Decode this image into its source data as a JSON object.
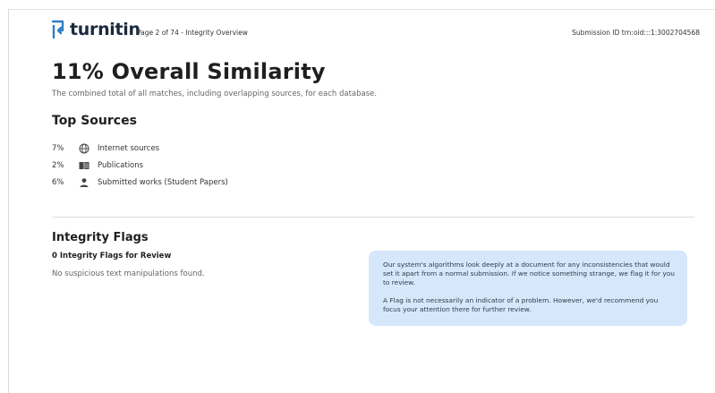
{
  "header": {
    "logo_text": "turnitin",
    "page_label": "Page 2 of 74 - Integrity Overview",
    "submission_id": "Submission ID trn:oid:::1:3002704568",
    "logo_icon": "turnitin-logo-icon",
    "brand_color": "#2f7dc6"
  },
  "overview": {
    "title": "11% Overall Similarity",
    "subtitle": "The combined total of all matches, including overlapping sources, for each database."
  },
  "top_sources": {
    "heading": "Top Sources",
    "items": [
      {
        "percent": "7%",
        "icon": "globe-icon",
        "label": "Internet sources"
      },
      {
        "percent": "2%",
        "icon": "book-icon",
        "label": "Publications"
      },
      {
        "percent": "6%",
        "icon": "person-icon",
        "label": "Submitted works (Student Papers)"
      }
    ]
  },
  "integrity_flags": {
    "heading": "Integrity Flags",
    "count_text": "0 Integrity Flags for Review",
    "none_text": "No suspicious text manipulations found.",
    "info_paragraphs": [
      "Our system's algorithms look deeply at a document for any inconsistencies that would set it apart from a normal submission. If we notice something strange, we flag it for you to review.",
      "A Flag is not necessarily an indicator of a problem. However, we'd recommend you focus your attention there for further review."
    ],
    "info_bg": "#d6e7fb"
  }
}
